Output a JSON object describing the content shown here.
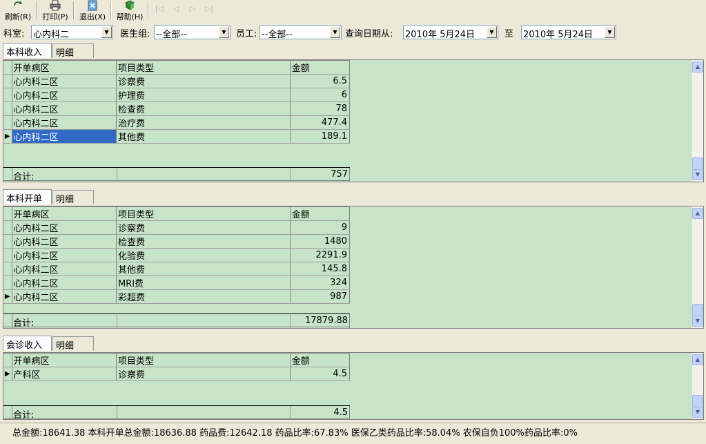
{
  "toolbar": {
    "refresh": "刷新(R)",
    "print": "打印(P)",
    "exit": "退出(X)",
    "help": "帮助(H)"
  },
  "filters": {
    "dept_label": "科室:",
    "dept_value": "心内科二",
    "doctor_group_label": "医生组:",
    "doctor_group_value": "--全部--",
    "staff_label": "员工:",
    "staff_value": "--全部--",
    "date_from_label": "查询日期从:",
    "date_from_value": "2010年  5月24日",
    "date_to_label": "至",
    "date_to_value": "2010年  5月24日"
  },
  "sections": [
    {
      "tabs": [
        "本科收入",
        "明细"
      ],
      "columns": [
        "开单病区",
        "项目类型",
        "金额"
      ],
      "rows": [
        [
          "心内科二区",
          "诊察费",
          "6.5"
        ],
        [
          "心内科二区",
          "护理费",
          "6"
        ],
        [
          "心内科二区",
          "检查费",
          "78"
        ],
        [
          "心内科二区",
          "治疗费",
          "477.4"
        ],
        [
          "心内科二区",
          "其他费",
          "189.1"
        ]
      ],
      "total_label": "合计:",
      "total_value": "757"
    },
    {
      "tabs": [
        "本科开单",
        "明细"
      ],
      "columns": [
        "开单病区",
        "项目类型",
        "金额"
      ],
      "rows": [
        [
          "心内科二区",
          "诊察费",
          "9"
        ],
        [
          "心内科二区",
          "检查费",
          "1480"
        ],
        [
          "心内科二区",
          "化验费",
          "2291.9"
        ],
        [
          "心内科二区",
          "其他费",
          "145.8"
        ],
        [
          "心内科二区",
          "MRI费",
          "324"
        ],
        [
          "心内科二区",
          "彩超费",
          "987"
        ]
      ],
      "total_label": "合计:",
      "total_value": "17879.88"
    },
    {
      "tabs": [
        "会诊收入",
        "明细"
      ],
      "columns": [
        "开单病区",
        "项目类型",
        "金额"
      ],
      "rows": [
        [
          "产科区",
          "诊察费",
          "4.5"
        ]
      ],
      "total_label": "合计:",
      "total_value": "4.5"
    }
  ],
  "status": {
    "text": "总金额:18641.38   本科开单总金额:18636.88   药品费:12642.18   药品比率:67.83%   医保乙类药品比率:58.04%   农保自负100%药品比率:0%"
  },
  "colors": {
    "grid_bg": "#c8e4c8",
    "selection": "#316ac5",
    "chrome": "#ece9d8"
  }
}
